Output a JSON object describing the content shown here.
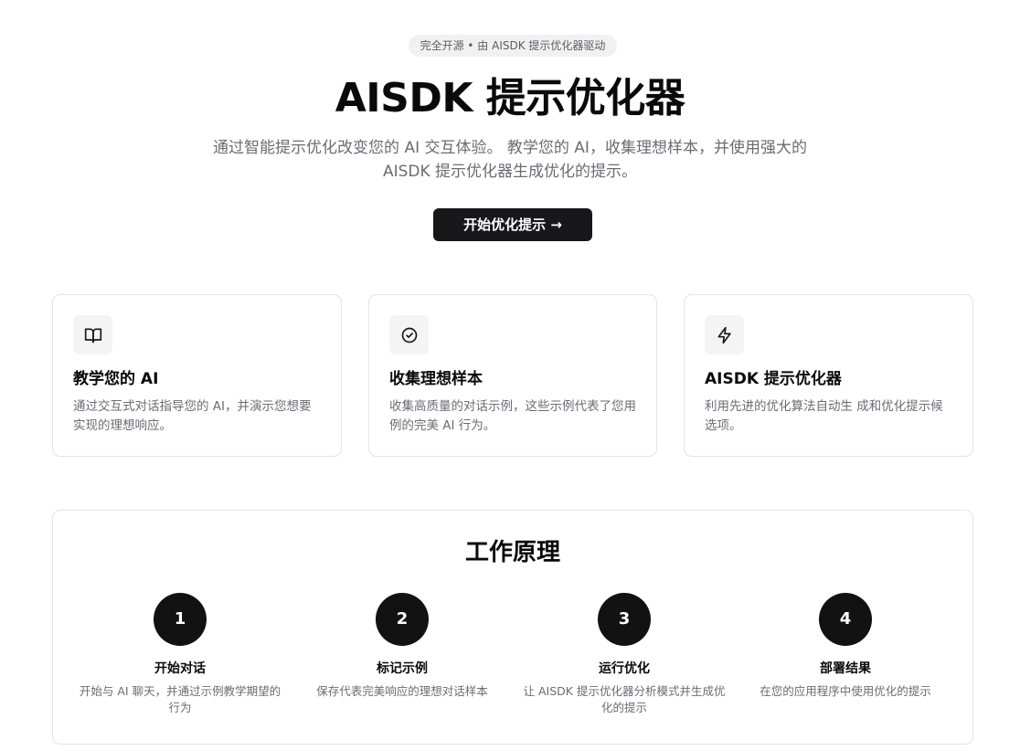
{
  "hero": {
    "badge": "完全开源 • 由 AISDK 提示优化器驱动",
    "title": "AISDK 提示优化器",
    "subtitle": "通过智能提示优化改变您的 AI 交互体验。 教学您的 AI，收集理想样本，并使用强大的 AISDK 提示优化器生成优化的提示。",
    "cta_label": "开始优化提示 →"
  },
  "features": [
    {
      "icon": "book-open-icon",
      "title": "教学您的 AI",
      "description": "通过交互式对话指导您的 AI，并演示您想要实现的理想响应。"
    },
    {
      "icon": "check-circle-icon",
      "title": "收集理想样本",
      "description": "收集高质量的对话示例，这些示例代表了您用例的完美 AI 行为。"
    },
    {
      "icon": "zap-icon",
      "title": "AISDK 提示优化器",
      "description": "利用先进的优化算法自动生 成和优化提示候选项。"
    }
  ],
  "how_it_works": {
    "title": "工作原理",
    "steps": [
      {
        "number": "1",
        "title": "开始对话",
        "description": "开始与 AI 聊天，并通过示例教学期望的行为"
      },
      {
        "number": "2",
        "title": "标记示例",
        "description": "保存代表完美响应的理想对话样本"
      },
      {
        "number": "3",
        "title": "运行优化",
        "description": "让 AISDK 提示优化器分析模式并生成优化的提示"
      },
      {
        "number": "4",
        "title": "部署结果",
        "description": "在您的应用程序中使用优化的提示"
      }
    ]
  },
  "colors": {
    "primary": "#18181b",
    "muted_text": "#6b6b74",
    "border": "#e4e4e7",
    "badge_bg": "#f1f1f2"
  }
}
